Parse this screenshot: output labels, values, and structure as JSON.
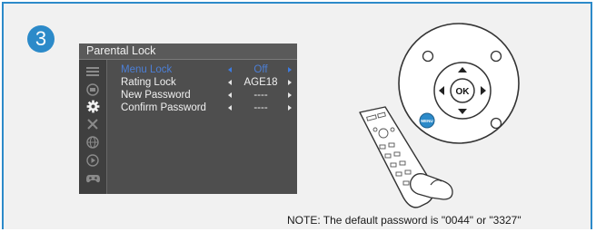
{
  "step": {
    "number": "3"
  },
  "osd": {
    "title": "Parental Lock",
    "rows": [
      {
        "label": "Menu Lock",
        "value": "Off"
      },
      {
        "label": "Rating Lock",
        "value": "AGE18"
      },
      {
        "label": "New Password",
        "value": "----"
      },
      {
        "label": "Confirm Password",
        "value": "----"
      }
    ],
    "side_icons": [
      "menu-lines-icon",
      "picture-icon",
      "settings-gear-icon",
      "tools-icon",
      "globe-icon",
      "play-icon",
      "game-controller-icon"
    ]
  },
  "remote": {
    "ok_label": "OK",
    "menu_label": "MENU"
  },
  "note": "NOTE: The default password is \"0044\" or \"3327\"",
  "colors": {
    "accent": "#2c8ac9",
    "selected_text": "#4c7fd6",
    "osd_background": "#4e4e4e"
  }
}
